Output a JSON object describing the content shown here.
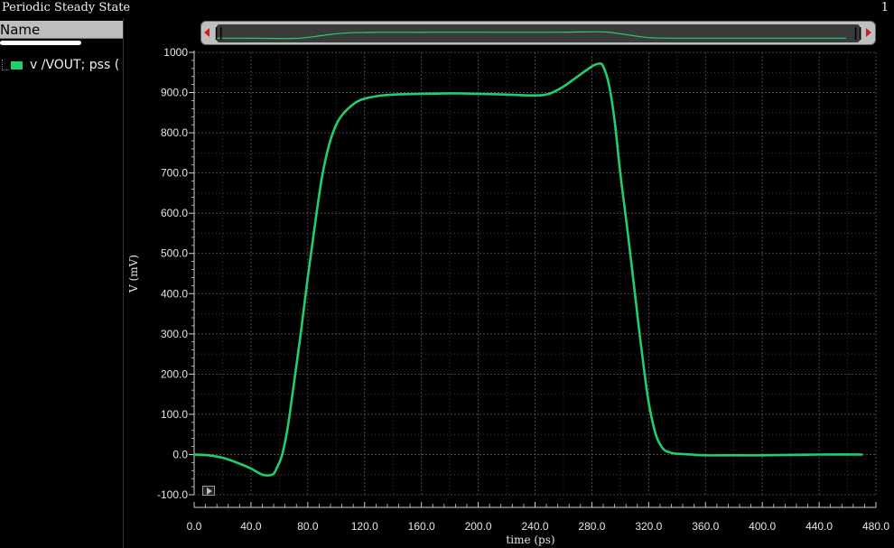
{
  "window": {
    "title": "Periodic Steady State",
    "page_indicator": "1"
  },
  "sidebar": {
    "column_header": "Name",
    "signal_label": "v /VOUT; pss (",
    "signal_color": "#1fcf6e"
  },
  "slider": {
    "left_handle": "||",
    "right_handle": "||"
  },
  "colors": {
    "background": "#000000",
    "grid": "#5a5a5a",
    "trace": "#1fcf6e",
    "axis_text": "#e6e6e6"
  },
  "chart_data": {
    "type": "line",
    "xlabel": "time (ps)",
    "ylabel": "V (mV)",
    "xlim": [
      0,
      480
    ],
    "ylim": [
      -100,
      1000
    ],
    "xticks": [
      0,
      40,
      80,
      120,
      160,
      200,
      240,
      280,
      320,
      360,
      400,
      440,
      480
    ],
    "xtick_labels": [
      "0.0",
      "40.0",
      "80.0",
      "120.0",
      "160.0",
      "200.0",
      "240.0",
      "280.0",
      "320.0",
      "360.0",
      "400.0",
      "440.0",
      "480.0"
    ],
    "yticks": [
      -100,
      0,
      100,
      200,
      300,
      400,
      500,
      600,
      700,
      800,
      900,
      1000
    ],
    "ytick_labels": [
      "-100.0",
      "0.0",
      "100.0",
      "200.0",
      "300.0",
      "400.0",
      "500.0",
      "600.0",
      "700.0",
      "800.0",
      "900.0",
      "1000"
    ],
    "grid": true,
    "series": [
      {
        "name": "v /VOUT; pss",
        "x": [
          0,
          10,
          20,
          30,
          40,
          48,
          55,
          58,
          62,
          66,
          70,
          75,
          80,
          85,
          90,
          95,
          100,
          105,
          110,
          115,
          120,
          130,
          140,
          160,
          180,
          200,
          220,
          240,
          250,
          260,
          270,
          280,
          285,
          288,
          292,
          296,
          300,
          305,
          310,
          315,
          320,
          325,
          330,
          335,
          340,
          350,
          360,
          380,
          400,
          440,
          470
        ],
        "y": [
          0,
          -2,
          -8,
          -20,
          -35,
          -50,
          -50,
          -35,
          0,
          70,
          170,
          300,
          440,
          570,
          690,
          770,
          820,
          848,
          865,
          878,
          885,
          892,
          895,
          897,
          898,
          897,
          895,
          893,
          897,
          915,
          940,
          965,
          972,
          965,
          920,
          830,
          700,
          560,
          410,
          260,
          130,
          50,
          15,
          5,
          2,
          0,
          -2,
          -2,
          -2,
          0,
          0
        ]
      }
    ]
  }
}
